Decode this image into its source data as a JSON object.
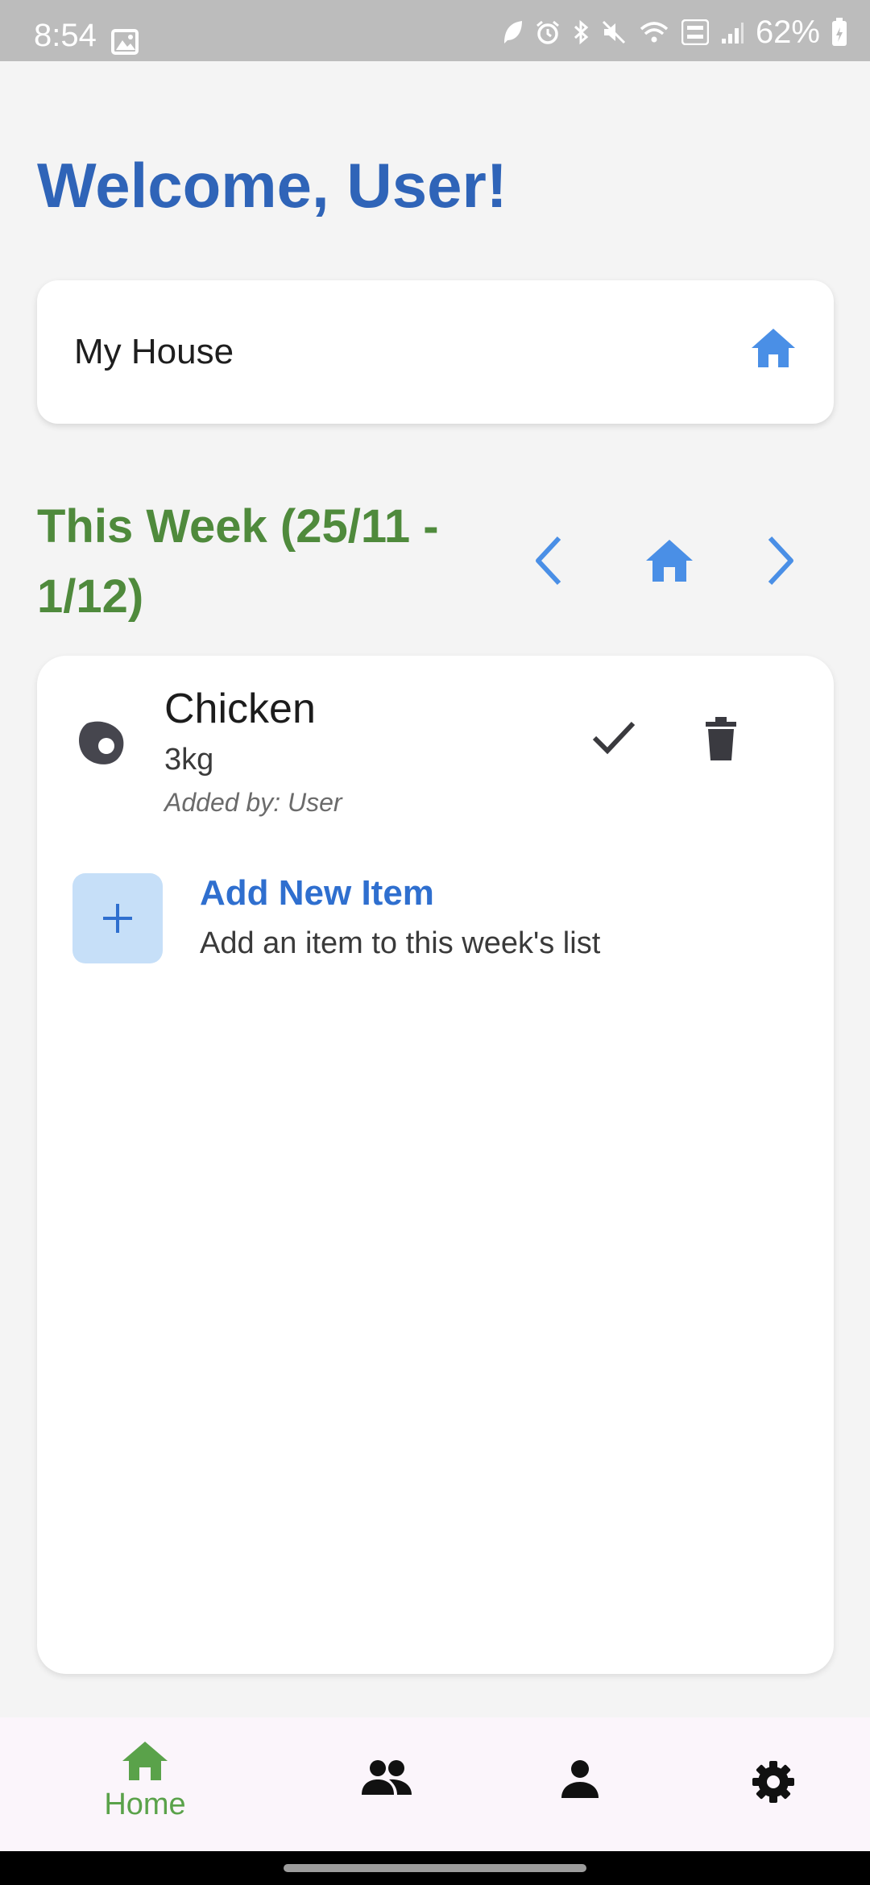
{
  "status_bar": {
    "time": "8:54",
    "battery": "62%",
    "icons": [
      "image-icon",
      "leaf-icon",
      "alarm-icon",
      "bluetooth-icon",
      "mute-icon",
      "wifi-icon",
      "volte-icon",
      "signal-icon",
      "battery-icon"
    ]
  },
  "welcome": "Welcome, User!",
  "house": {
    "name": "My House",
    "icon": "home-icon"
  },
  "week": {
    "title": "This Week (25/11 - 1/12)",
    "nav_icons": [
      "chevron-left-icon",
      "home-icon",
      "chevron-right-icon"
    ]
  },
  "items": [
    {
      "name": "Chicken",
      "quantity": "3kg",
      "added_by": "Added by: User",
      "icon": "egg-icon"
    }
  ],
  "add_item": {
    "title": "Add New Item",
    "subtitle": "Add an item to this week's list"
  },
  "bottom_nav": {
    "items": [
      {
        "label": "Home",
        "icon": "home-icon",
        "active": true
      },
      {
        "label": "",
        "icon": "group-icon"
      },
      {
        "label": "",
        "icon": "person-icon"
      },
      {
        "label": "",
        "icon": "settings-icon"
      }
    ]
  },
  "colors": {
    "primary_blue": "#2f64b8",
    "icon_blue": "#4a8fe6",
    "green": "#4f8a3c",
    "nav_green": "#5aa24a",
    "background": "#f4f4f4"
  }
}
